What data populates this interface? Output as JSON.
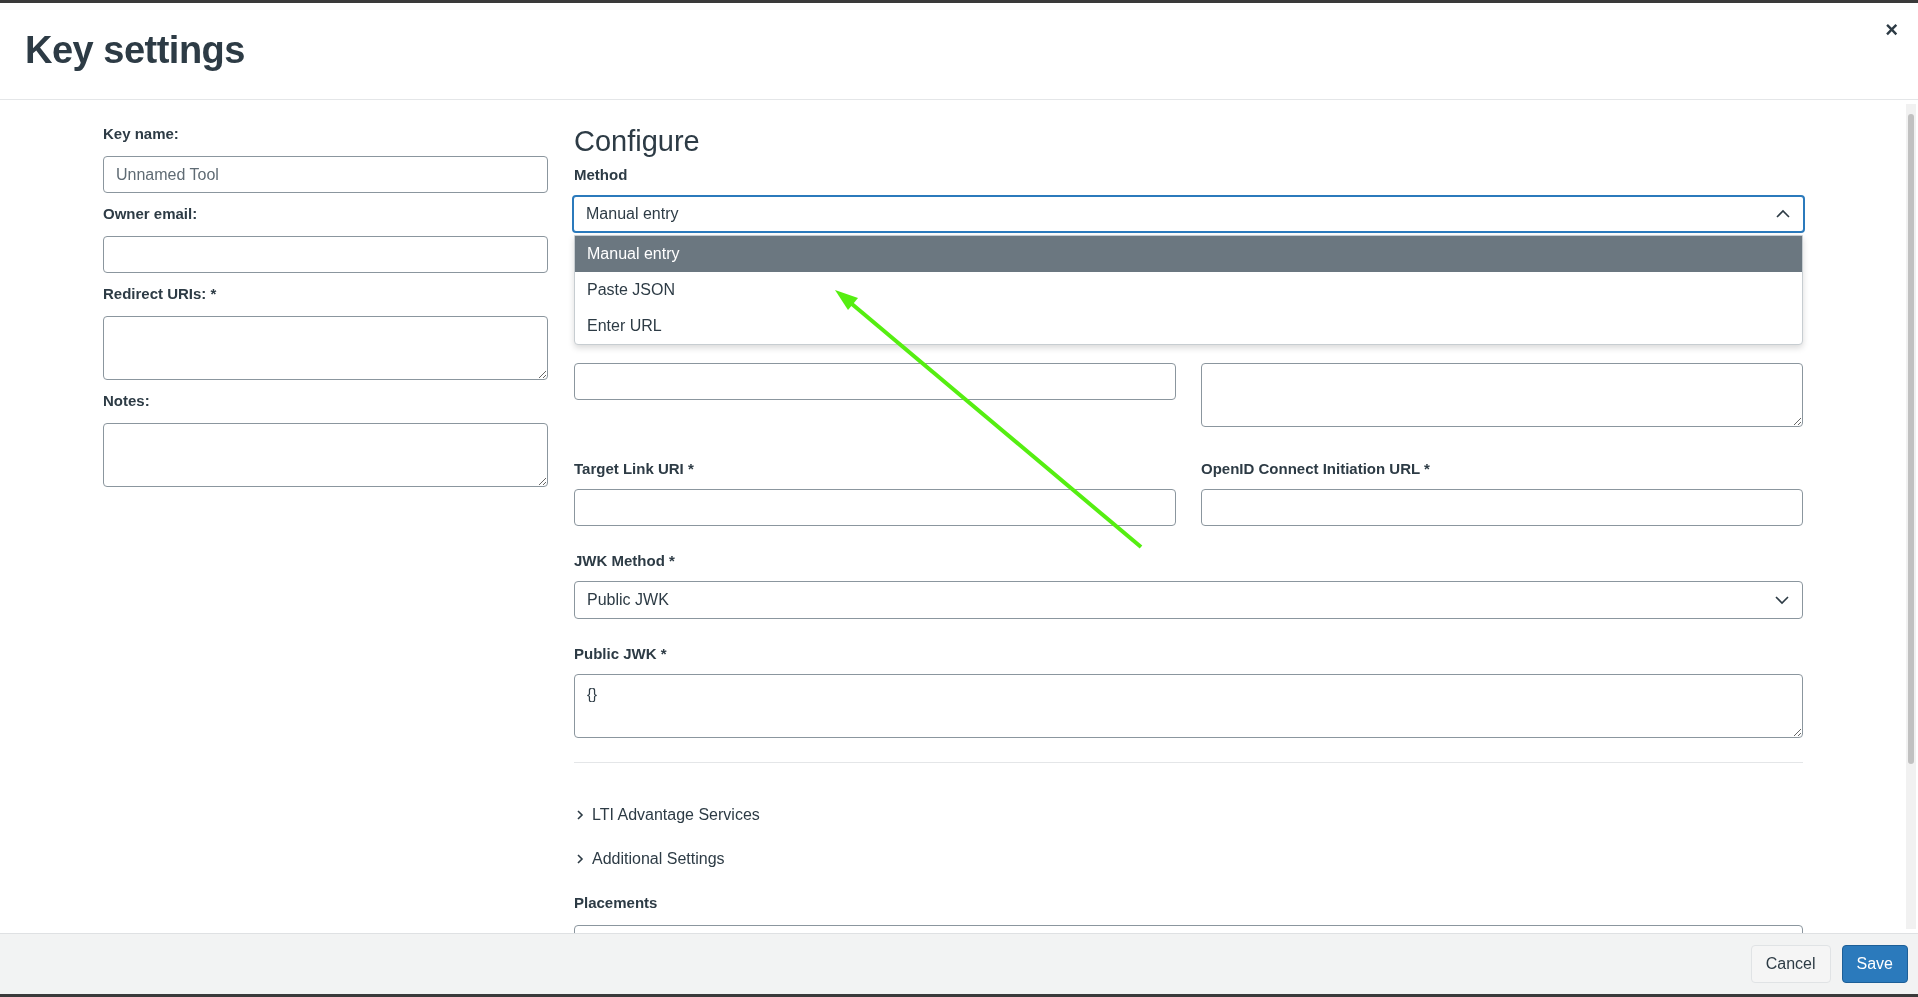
{
  "dialog": {
    "title": "Key settings",
    "close": "×"
  },
  "left_fields": [
    {
      "label": "Key name:",
      "placeholder": "Unnamed Tool",
      "kind": "input"
    },
    {
      "label": "Owner email:",
      "kind": "input"
    },
    {
      "label": "Redirect URIs: *",
      "kind": "textarea"
    },
    {
      "label": "Notes:",
      "kind": "textarea"
    }
  ],
  "configure": {
    "heading": "Configure",
    "method": {
      "label": "Method",
      "value": "Manual entry",
      "expanded": true,
      "options": [
        {
          "label": "Manual entry",
          "selected": true
        },
        {
          "label": "Paste JSON",
          "selected": false
        },
        {
          "label": "Enter URL",
          "selected": false
        }
      ]
    },
    "fields": [
      {
        "kind": "input"
      },
      {
        "kind": "textarea"
      },
      {
        "label": "Target Link URI *",
        "kind": "input"
      },
      {
        "label": "OpenID Connect Initiation URL *",
        "kind": "input"
      }
    ],
    "jwk_method": {
      "label": "JWK Method *",
      "value": "Public JWK"
    },
    "public_jwk": {
      "label": "Public JWK *",
      "value": "{}"
    },
    "sections": [
      {
        "label": "LTI Advantage Services",
        "expanded": false
      },
      {
        "label": "Additional Settings",
        "expanded": false
      }
    ],
    "placements": {
      "label": "Placements"
    }
  },
  "footer": {
    "buttons": [
      {
        "label": "Cancel",
        "kind": "secondary"
      },
      {
        "label": "Save",
        "kind": "primary"
      }
    ]
  }
}
